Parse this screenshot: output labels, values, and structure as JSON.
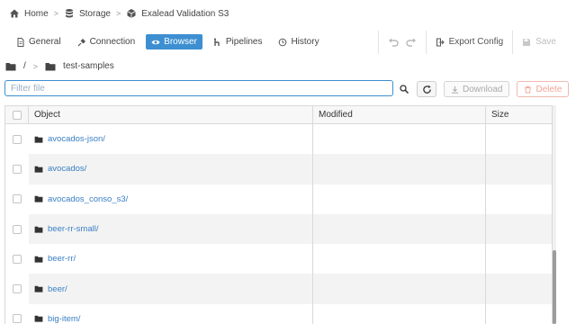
{
  "breadcrumb": {
    "items": [
      {
        "label": "Home",
        "icon": "home-icon"
      },
      {
        "label": "Storage",
        "icon": "database-icon"
      },
      {
        "label": "Exalead Validation S3",
        "icon": "cube-icon"
      }
    ],
    "separator": ">"
  },
  "tabs": [
    {
      "label": "General",
      "icon": "document-icon",
      "active": false
    },
    {
      "label": "Connection",
      "icon": "plug-icon",
      "active": false
    },
    {
      "label": "Browser",
      "icon": "eye-icon",
      "active": true
    },
    {
      "label": "Pipelines",
      "icon": "pipeline-icon",
      "active": false
    },
    {
      "label": "History",
      "icon": "history-icon",
      "active": false
    }
  ],
  "toolbar": {
    "export_label": "Export Config",
    "save_label": "Save"
  },
  "path": {
    "root": "/",
    "separator": ">",
    "current": "test-samples"
  },
  "filter": {
    "placeholder": "Filter file",
    "value": ""
  },
  "actions": {
    "download_label": "Download",
    "delete_label": "Delete"
  },
  "table": {
    "columns": [
      "Object",
      "Modified",
      "Size"
    ],
    "rows": [
      {
        "name": "avocados-json/",
        "modified": "",
        "size": ""
      },
      {
        "name": "avocados/",
        "modified": "",
        "size": ""
      },
      {
        "name": "avocados_conso_s3/",
        "modified": "",
        "size": ""
      },
      {
        "name": "beer-rr-small/",
        "modified": "",
        "size": ""
      },
      {
        "name": "beer-rr/",
        "modified": "",
        "size": ""
      },
      {
        "name": "beer/",
        "modified": "",
        "size": ""
      },
      {
        "name": "big-item/",
        "modified": "",
        "size": ""
      }
    ]
  },
  "colors": {
    "accent": "#3d8fd1",
    "link": "#3a7fc4",
    "danger": "#f0a597"
  }
}
